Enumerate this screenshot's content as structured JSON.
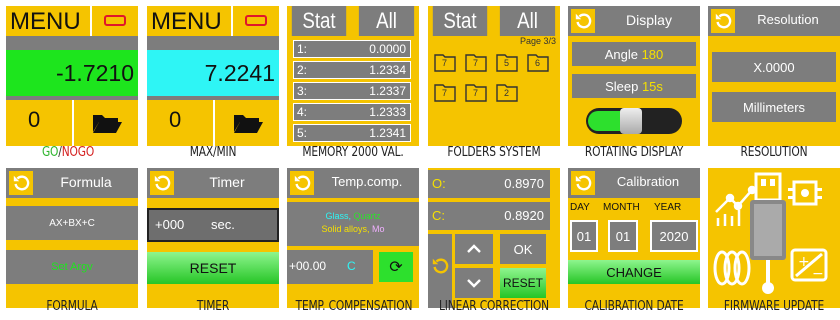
{
  "captions": [
    "GO/NOGO",
    "MAX/MIN",
    "MEMORY 2000 VAL.",
    "FOLDERS SYSTEM",
    "ROTATING DISPLAY",
    "RESOLUTION",
    "FORMULA",
    "TIMER",
    "TEMP. COMPENSATION",
    "LINEAR CORRECTION",
    "CALIBRATION DATE",
    "FIRMWARE UPDATE"
  ],
  "caption_go": "GO",
  "caption_slash": "/",
  "caption_nogo": "NOGO",
  "gonogo": {
    "menu": "MENU",
    "value": "-1.7210",
    "count": "0"
  },
  "maxmin": {
    "menu": "MENU",
    "value": "7.2241",
    "count": "0"
  },
  "memory": {
    "tab_stat": "Stat",
    "tab_all": "All",
    "rows": [
      {
        "idx": "1:",
        "val": "0.0000"
      },
      {
        "idx": "2:",
        "val": "1.2334"
      },
      {
        "idx": "3:",
        "val": "1.2337"
      },
      {
        "idx": "4:",
        "val": "1.2333"
      },
      {
        "idx": "5:",
        "val": "1.2341"
      }
    ]
  },
  "folders": {
    "tab_stat": "Stat",
    "tab_all": "All",
    "page": "Page 3/3",
    "items": [
      "7",
      "7",
      "5",
      "6",
      "7",
      "7",
      "2"
    ]
  },
  "display": {
    "title": "Display",
    "angle_label": "Angle",
    "angle_value": "180",
    "sleep_label": "Sleep",
    "sleep_value": "15s"
  },
  "resolution": {
    "title": "Resolution",
    "option1": "X.0000",
    "option2": "Millimeters"
  },
  "formula": {
    "title": "Formula",
    "expression": "AX+BX+C",
    "action": "Set Argv"
  },
  "timer": {
    "title": "Timer",
    "value": "+000",
    "unit": "sec.",
    "reset": "RESET"
  },
  "temp": {
    "title": "Temp.comp.",
    "mat1": "Glass,",
    "mat2": "Quartz",
    "mat3": "Solid alloys,",
    "mat4": "Mo",
    "value": "+00.00",
    "unit": "C"
  },
  "linear": {
    "label_o": "O:",
    "value_o": "0.8970",
    "label_c": "C:",
    "value_c": "0.8920",
    "ok": "OK",
    "reset": "RESET"
  },
  "calibration": {
    "title": "Calibration",
    "day_label": "DAY",
    "month_label": "MONTH",
    "year_label": "YEAR",
    "day": "01",
    "month": "01",
    "year": "2020",
    "change": "CHANGE"
  },
  "colors": {
    "yellow": "#f5c400",
    "gray": "#7d7d7d",
    "green": "#1de51d",
    "cyan": "#2ef5f5",
    "go_green": "#2db52d",
    "nogo_red": "#d42020"
  }
}
